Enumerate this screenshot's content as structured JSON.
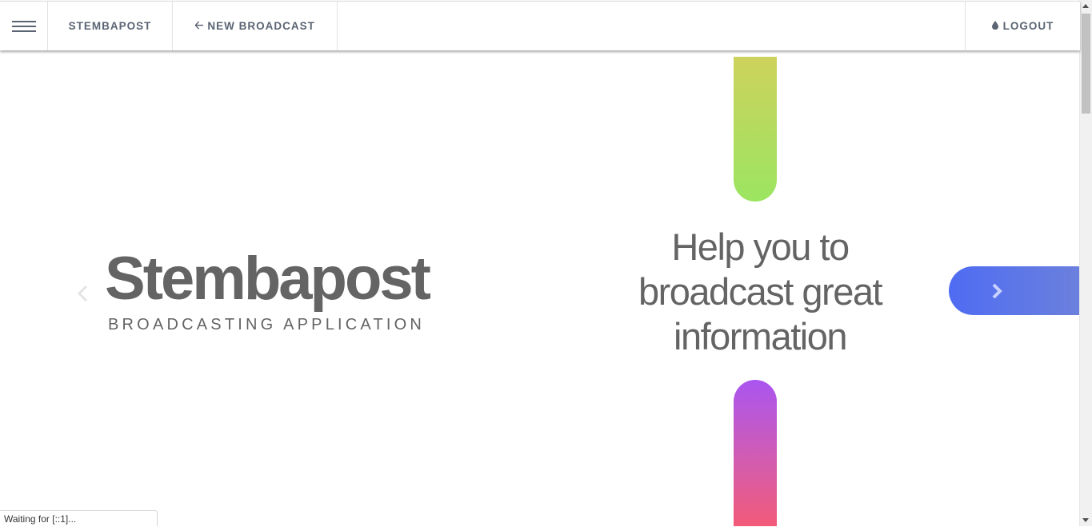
{
  "nav": {
    "menu_icon": "hamburger-menu-icon",
    "brand": "STEMBAPOST",
    "new_broadcast_icon": "arrow-left-icon",
    "new_broadcast": "NEW BROADCAST",
    "logout_icon": "water-drop-icon",
    "logout": "LOGOUT"
  },
  "slide": {
    "logo_wordmark": "Stembapost",
    "logo_tagline": "BROADCASTING APPLICATION",
    "tagline_lines": [
      "Help you to",
      "broadcast great",
      "information"
    ],
    "prev_icon": "chevron-left-icon",
    "next_icon": "chevron-right-icon"
  },
  "colors": {
    "nav_text": "#5a6472",
    "logo_text": "#646464",
    "pill_top": [
      "#cdd25c",
      "#9be561"
    ],
    "pill_bottom": [
      "#aa55f0",
      "#d25cb0",
      "#f25a78"
    ],
    "next_button": [
      "#4f6cf2",
      "#6b80dd"
    ]
  },
  "status_bar": {
    "text": "Waiting for [::1]..."
  }
}
